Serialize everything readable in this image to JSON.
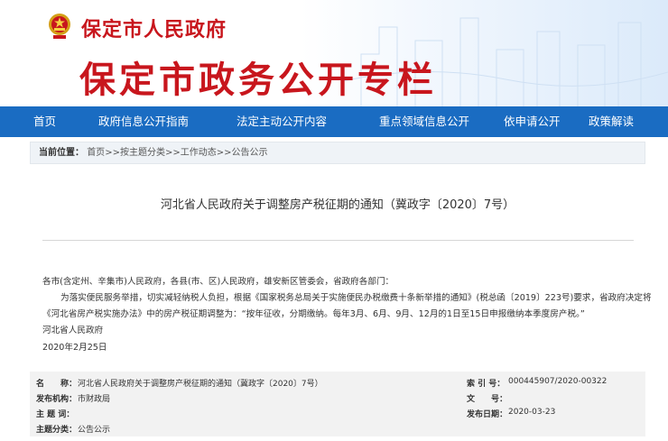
{
  "header": {
    "gov_name": "保定市人民政府",
    "column_title": "保定市政务公开专栏"
  },
  "nav": {
    "items": [
      {
        "label": "首页"
      },
      {
        "label": "政府信息公开指南"
      },
      {
        "label": "法定主动公开内容"
      },
      {
        "label": "重点领域信息公开"
      },
      {
        "label": "依申请公开"
      },
      {
        "label": "政策解读"
      }
    ]
  },
  "breadcrumb": {
    "label": "当前位置：",
    "items": [
      "首页",
      "按主题分类",
      "工作动态",
      "公告公示"
    ],
    "separator": ">>"
  },
  "article": {
    "title": "河北省人民政府关于调整房产税征期的通知（冀政字〔2020〕7号）",
    "salutation": "各市(含定州、辛集市)人民政府，各县(市、区)人民政府，雄安新区管委会，省政府各部门：",
    "para1_line1": "为落实便民服务举措，切实减轻纳税人负担，根据《国家税务总局关于实施便民办税缴费十条新举措的通知》(税总函〔2019〕223号)要求，省政府决定将",
    "para1_line2": "《河北省房产税实施办法》中的房产税征期调整为：“按年征收，分期缴纳。每年3月、6月、9月、12月的1日至15日申报缴纳本季度房产税。”",
    "signature": "河北省人民政府",
    "date": "2020年2月25日"
  },
  "info": {
    "name_key": "名　　称：",
    "name_value": "河北省人民政府关于调整房产税征期的通知（冀政字〔2020〕7号）",
    "index_key": "索 引 号：",
    "index_value": "000445907/2020-00322",
    "org_key": "发布机构：",
    "org_value": "市财政局",
    "docno_key": "文　　号：",
    "docno_value": "",
    "subject_key": "主 题 词：",
    "subject_value": "",
    "date_key": "发布日期：",
    "date_value": "2020-03-23",
    "category_key": "主题分类：",
    "category_value": "公告公示"
  },
  "colors": {
    "brand_red": "#c8161d",
    "nav_blue": "#1a6cc2"
  }
}
